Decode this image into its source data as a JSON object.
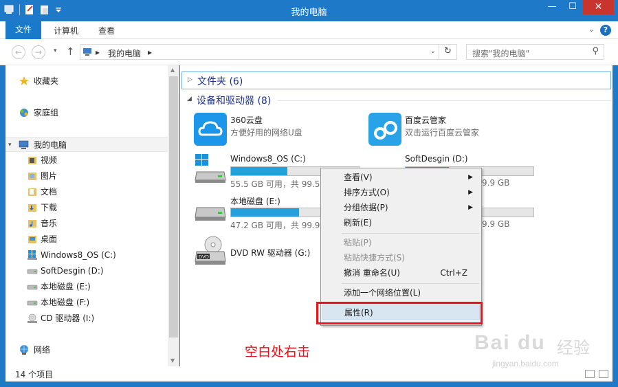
{
  "window": {
    "title": "我的电脑",
    "buttons": {
      "minimize": "—",
      "maximize": "☐",
      "close": "✕"
    }
  },
  "ribbon": {
    "tabs": [
      "文件",
      "计算机",
      "查看"
    ],
    "help": "?"
  },
  "address": {
    "crumbs": [
      "我的电脑"
    ],
    "separator": "▸",
    "search_placeholder": "搜索\"我的电脑\""
  },
  "nav": {
    "items": [
      {
        "label": "收藏夹",
        "icon": "star-icon"
      },
      {
        "label": "家庭组",
        "icon": "homegroup-icon"
      },
      {
        "label": "我的电脑",
        "icon": "computer-icon"
      },
      {
        "label": "视频",
        "icon": "video-folder-icon"
      },
      {
        "label": "图片",
        "icon": "pictures-folder-icon"
      },
      {
        "label": "文档",
        "icon": "documents-folder-icon"
      },
      {
        "label": "下载",
        "icon": "downloads-folder-icon"
      },
      {
        "label": "音乐",
        "icon": "music-folder-icon"
      },
      {
        "label": "桌面",
        "icon": "desktop-folder-icon"
      },
      {
        "label": "Windows8_OS (C:)",
        "icon": "windows-drive-icon"
      },
      {
        "label": "SoftDesgin (D:)",
        "icon": "drive-icon"
      },
      {
        "label": "本地磁盘 (E:)",
        "icon": "drive-icon"
      },
      {
        "label": "本地磁盘 (F:)",
        "icon": "drive-icon"
      },
      {
        "label": "CD 驱动器 (I:)",
        "icon": "cd-drive-icon"
      },
      {
        "label": "网络",
        "icon": "network-icon"
      }
    ]
  },
  "content": {
    "folders_group": "文件夹 (6)",
    "devices_group": "设备和驱动器 (8)",
    "tiles": [
      {
        "name": "360云盘",
        "sub": "方便好用的网络U盘",
        "icon": "360-cloud-icon"
      },
      {
        "name": "百度云管家",
        "sub": "双击运行百度云管家",
        "icon": "baidu-cloud-icon"
      },
      {
        "name": "Windows8_OS (C:)",
        "free": "55.5 GB 可用，共 99.5",
        "used_fraction": 0.44,
        "icon": "windows-drive-icon"
      },
      {
        "name": "SoftDesgin (D:)",
        "free": "9.9 GB",
        "used_fraction": 0.34,
        "icon": "drive-icon"
      },
      {
        "name": "本地磁盘 (E:)",
        "free": "47.2 GB 可用，共 99.9",
        "used_fraction": 0.53,
        "icon": "drive-icon"
      },
      {
        "name": "",
        "free": "9.9 GB",
        "used_fraction": 0.4,
        "icon": "drive-icon"
      },
      {
        "name": "DVD RW 驱动器 (G:)",
        "icon": "dvd-drive-icon"
      }
    ]
  },
  "context_menu": {
    "items": [
      {
        "label": "查看(V)",
        "submenu": true
      },
      {
        "label": "排序方式(O)",
        "submenu": true
      },
      {
        "label": "分组依据(P)",
        "submenu": true
      },
      {
        "label": "刷新(E)"
      },
      {
        "label": "粘贴(P)",
        "disabled": true
      },
      {
        "label": "粘贴快捷方式(S)",
        "disabled": true
      },
      {
        "label": "撤消 重命名(U)",
        "shortcut": "Ctrl+Z"
      },
      {
        "label": "添加一个网络位置(L)"
      },
      {
        "label": "属性(R)",
        "highlighted": true
      }
    ],
    "submenu_glyph": "▶"
  },
  "status": {
    "count": "14 个项目"
  },
  "annotation": "空白处右击",
  "watermark": {
    "brand": "Bai du",
    "cn": "经验",
    "url": "jingyan.baidu.com"
  },
  "colors": {
    "accent": "#1f79c9",
    "drive_fill": "#26a0da",
    "highlight_box": "#e8141b"
  }
}
